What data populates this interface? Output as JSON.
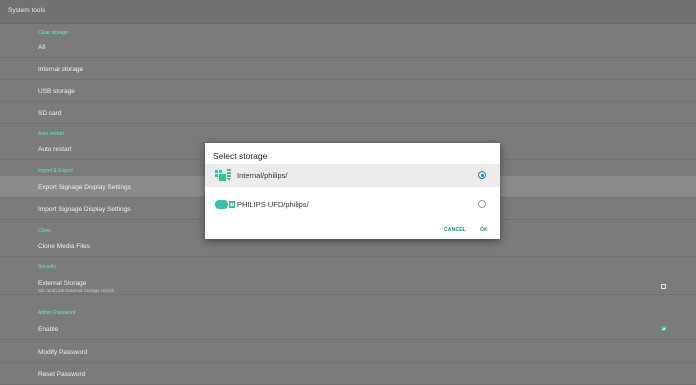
{
  "header": {
    "title": "System tools"
  },
  "sections": {
    "clear_storage": "Clear storage",
    "auto_restart": "Auto restart",
    "import_export": "Import & Export",
    "clone": "Clone",
    "security": "Security",
    "admin_password": "Admin Password"
  },
  "items": {
    "all": "All",
    "internal_storage": "Internal storage",
    "usb_storage": "USB storage",
    "sd_card": "SD card",
    "auto_restart": "Auto restart",
    "export_settings": "Export Signage Display Settings",
    "import_settings": "Import Signage Display Settings",
    "clone_media": "Clone Media Files",
    "external_storage": "External Storage",
    "external_storage_sub": "SD card/USB External Storage Unlock",
    "enable": "Enable",
    "modify_password": "Modify Password",
    "reset_password": "Reset Password"
  },
  "checkboxes": {
    "external_storage": false,
    "enable": true
  },
  "nav": {
    "left": "›",
    "right": "‹"
  },
  "dialog": {
    "title": "Select storage",
    "options": [
      {
        "label": "Internal/philips/",
        "icon": "internal-storage-icon",
        "selected": true
      },
      {
        "label": "PHILIPS UFD/philips/",
        "icon": "usb-drive-icon",
        "selected": false
      }
    ],
    "cancel": "CANCEL",
    "ok": "OK"
  },
  "colors": {
    "accent": "#47b19b",
    "button_text": "#1a8f86",
    "radio": "#2f7dbf",
    "section_label": "#6ee0c4"
  }
}
